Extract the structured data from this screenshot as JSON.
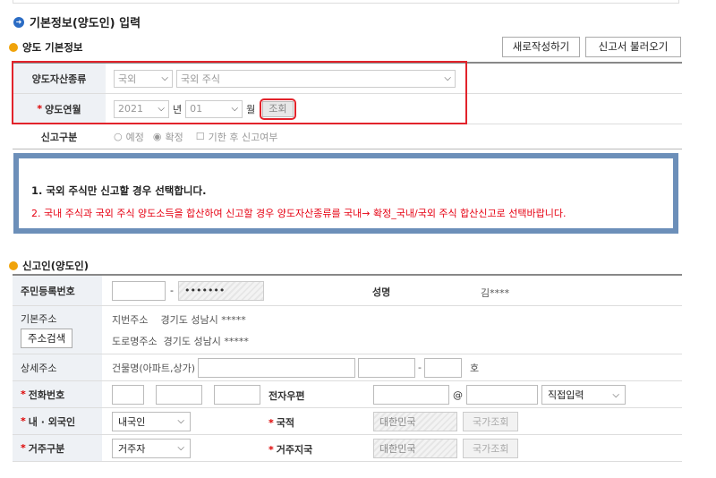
{
  "title": "기본정보(양도인) 입력",
  "section1": {
    "heading": "양도 기본정보",
    "new_button": "새로작성하기",
    "load_button": "신고서 불러오기",
    "asset_type_label": "양도자산종류",
    "asset_type_value1": "국외",
    "asset_type_value2": "국외 주식",
    "month_label": "양도연월",
    "year_value": "2021",
    "year_suffix": "년",
    "month_value": "01",
    "month_suffix": "월",
    "search_button": "조회",
    "report_type_label": "신고구분",
    "radio_estimate": "예정",
    "radio_final": "확정",
    "late_check": "기한 후 신고여부"
  },
  "notice": {
    "line1": "1. 국외 주식만 신고할 경우 선택합니다.",
    "line2": "2. 국내 주식과 국외 주식 양도소득을 합산하여 신고할 경우 양도자산종류를 국내→ 확정_국내/국외 주식 합산신고로 선택바랍니다."
  },
  "section2": {
    "heading": "신고인(양도인)",
    "rrn_label": "주민등록번호",
    "rrn_dash": "-",
    "rrn_masked": "•••••••",
    "name_label": "성명",
    "name_value": "김****",
    "address_label": "기본주소",
    "address_search_button": "주소검색",
    "jibun_label": "지번주소",
    "jibun_value": "경기도 성남시 *****",
    "road_label": "도로명주소",
    "road_value": "경기도 성남시 *****",
    "detail_label": "상세주소",
    "building_label": "건물명(아파트,상가)",
    "detail_dash": "-",
    "ho_label": "호",
    "phone_label": "전화번호",
    "email_label": "전자우편",
    "email_at": "@",
    "email_domain_select": "직접입력",
    "nationality_type_label": "내 · 외국인",
    "nationality_type_value": "내국인",
    "country_label": "국적",
    "country_value": "대한민국",
    "country_button": "국가조회",
    "residence_label": "거주구분",
    "residence_value": "거주자",
    "residence_country_label": "거주지국",
    "residence_country_value": "대한민국",
    "residence_country_button": "국가조회"
  }
}
